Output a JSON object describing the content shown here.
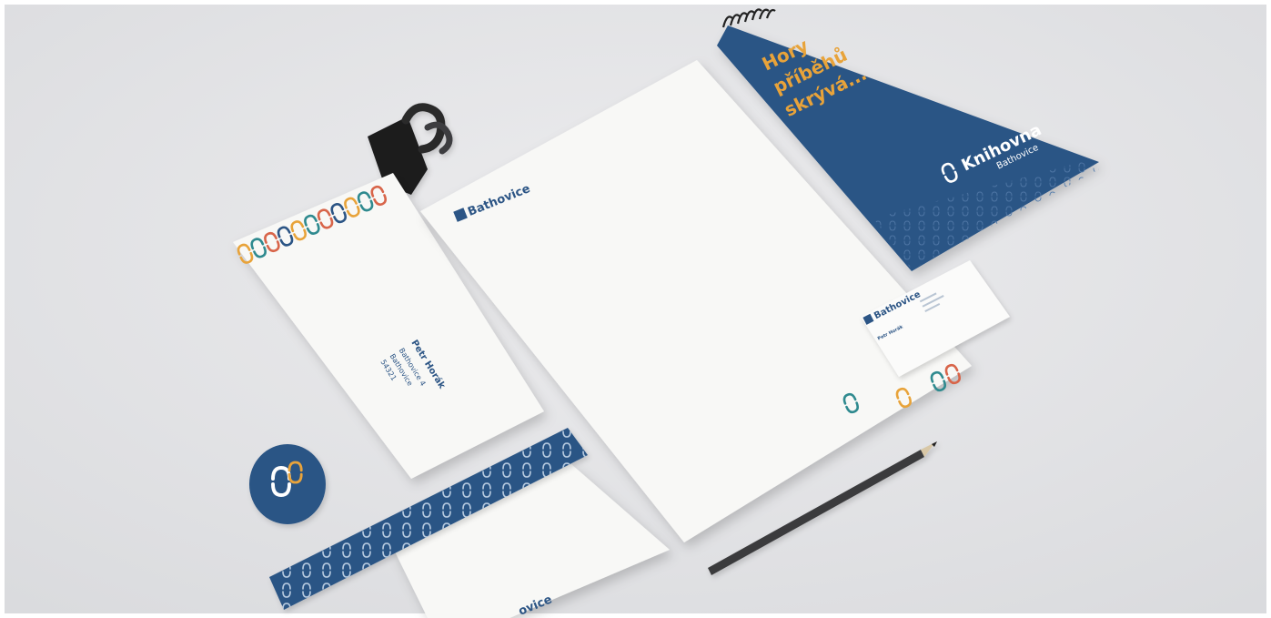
{
  "scene": {
    "colors": {
      "background": "#e4e5e7",
      "paper": "#f8f8f6",
      "navy": "#2c5585",
      "orange": "#e8a33a",
      "teal": "#2f8a8f",
      "coral": "#d8654a",
      "clip": "#1d1d1f",
      "pencil": "#3a3a3c"
    },
    "notebook": {
      "slogan_line1": "Hory",
      "slogan_line2": "příběhů",
      "slogan_line3": "skrývá...",
      "brand": "Knihovna",
      "brand_sub": "Bathovice"
    },
    "letterhead": {
      "logo_text": "Bathovice"
    },
    "business_card": {
      "logo_text": "Bathovice",
      "name": "Petr Horák"
    },
    "envelope": {
      "recipient_name": "Petr Horák",
      "street": "Bathovice 4",
      "town": "Bathovice",
      "zip": "54321"
    },
    "lower_sheet": {
      "logo_text_fragment": "ovice"
    }
  }
}
